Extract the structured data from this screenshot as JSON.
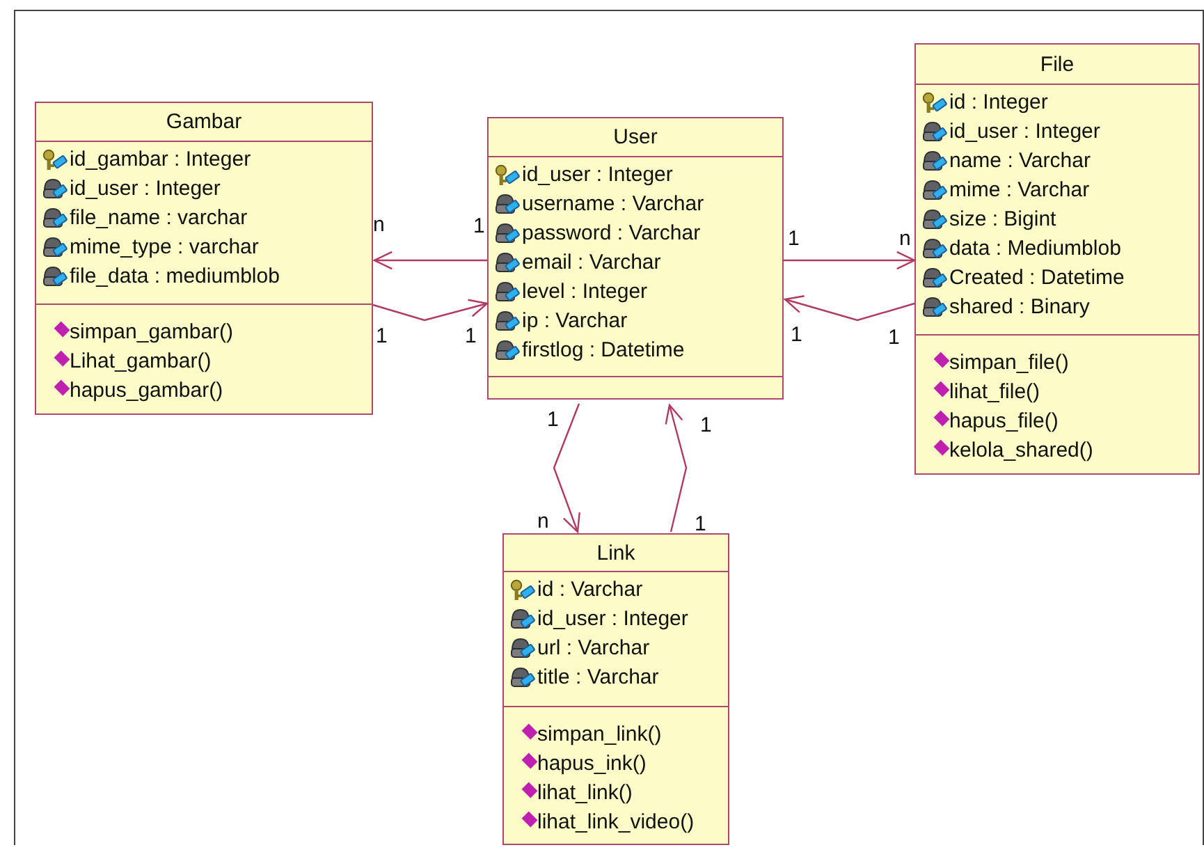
{
  "classes": [
    {
      "name": "Gambar",
      "attributes": [
        {
          "text": "id_gambar : Integer",
          "kind": "key"
        },
        {
          "text": "id_user : Integer",
          "kind": "field"
        },
        {
          "text": "file_name : varchar",
          "kind": "field"
        },
        {
          "text": "mime_type : varchar",
          "kind": "field"
        },
        {
          "text": "file_data : mediumblob",
          "kind": "field"
        }
      ],
      "methods": [
        "simpan_gambar()",
        "Lihat_gambar()",
        "hapus_gambar()"
      ]
    },
    {
      "name": "User",
      "attributes": [
        {
          "text": "id_user : Integer",
          "kind": "key"
        },
        {
          "text": "username : Varchar",
          "kind": "field"
        },
        {
          "text": "password : Varchar",
          "kind": "field"
        },
        {
          "text": "email : Varchar",
          "kind": "field"
        },
        {
          "text": "level : Integer",
          "kind": "field"
        },
        {
          "text": "ip : Varchar",
          "kind": "field"
        },
        {
          "text": "firstlog : Datetime",
          "kind": "field"
        }
      ]
    },
    {
      "name": "File",
      "attributes": [
        {
          "text": "id : Integer",
          "kind": "key"
        },
        {
          "text": "id_user : Integer",
          "kind": "field"
        },
        {
          "text": "name : Varchar",
          "kind": "field"
        },
        {
          "text": "mime : Varchar",
          "kind": "field"
        },
        {
          "text": "size : Bigint",
          "kind": "field"
        },
        {
          "text": "data : Mediumblob",
          "kind": "field"
        },
        {
          "text": "Created : Datetime",
          "kind": "field"
        },
        {
          "text": "shared : Binary",
          "kind": "field"
        }
      ],
      "methods": [
        "simpan_file()",
        "lihat_file()",
        "hapus_file()",
        "kelola_shared()"
      ]
    },
    {
      "name": "Link",
      "attributes": [
        {
          "text": "id : Varchar",
          "kind": "key"
        },
        {
          "text": "id_user : Integer",
          "kind": "field"
        },
        {
          "text": "url : Varchar",
          "kind": "field"
        },
        {
          "text": "title : Varchar",
          "kind": "field"
        }
      ],
      "methods": [
        "simpan_link()",
        "hapus_ink()",
        "lihat_link()",
        "lihat_link_video()"
      ]
    }
  ],
  "associations": [
    {
      "source_multiplicity": "1",
      "target_multiplicity": "n"
    },
    {
      "source_multiplicity": "1",
      "target_multiplicity": "1"
    },
    {
      "source_multiplicity": "1",
      "target_multiplicity": "n"
    },
    {
      "source_multiplicity": "1",
      "target_multiplicity": "1"
    },
    {
      "source_multiplicity": "1",
      "target_multiplicity": "n"
    },
    {
      "source_multiplicity": "1",
      "target_multiplicity": "1"
    }
  ]
}
